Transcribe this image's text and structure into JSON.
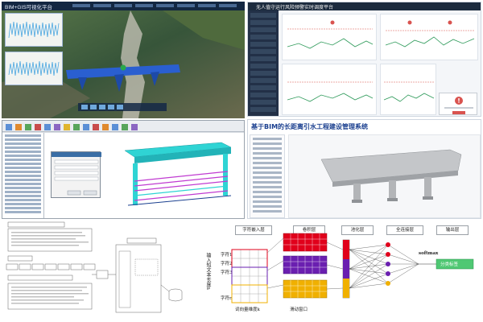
{
  "panel_a": {
    "title": "BIM+GIS可视化平台",
    "colors": {
      "header": "#132742",
      "terrain": "#3d5a3a",
      "bridge": "#2a5fd0",
      "marker": "#2aa84a"
    },
    "toolbar_icons": [
      "zoom-in-icon",
      "zoom-out-icon",
      "layers-icon",
      "measure-icon",
      "home-icon"
    ]
  },
  "panel_b": {
    "title": "无人值守运行风险预警实时调度平台",
    "colors": {
      "header": "#1c2b3e",
      "sidebar": "#223047",
      "line": "#2e9a5a",
      "limit": "#d9534f",
      "alert": "#d9534f"
    }
  },
  "panel_c": {
    "colors": {
      "model": "#2fd4d4",
      "rebar": "#c03bd1",
      "ribbon": "#e9ecf0"
    }
  },
  "panel_d": {
    "title": "基于BIM的长距离引水工程建设管理系统",
    "colors": {
      "title": "#1a3f8f",
      "model": "#b7b9bc"
    }
  },
  "panel_e": {
    "colors": {
      "box": "#ffffff",
      "border": "#666666"
    }
  },
  "panel_f": {
    "headers": [
      "字符嵌入层",
      "卷积层",
      "池化层",
      "全连接层",
      "输出层"
    ],
    "side_title": "输入短文本长度n",
    "row_label": "字符",
    "row_indices": [
      "1",
      "2",
      "3"
    ],
    "row_last": "n",
    "vocab_label": "词向量维度k",
    "window_label": "滑动窗口",
    "softmax_label": "softmax",
    "output_label": "分类标签",
    "colors": {
      "red": "#e0001b",
      "purple": "#6a1fb0",
      "gold": "#f0b000",
      "output": "#4fc873"
    }
  }
}
